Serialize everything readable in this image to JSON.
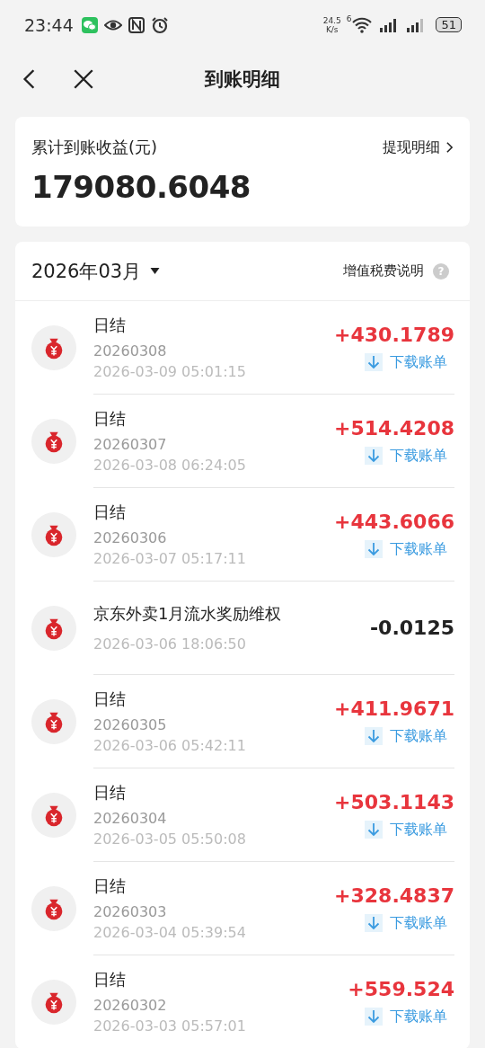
{
  "status_bar": {
    "time": "23:44",
    "net_speed": "24.5",
    "net_unit": "K/s",
    "wifi_badge": "6",
    "battery": "51"
  },
  "header": {
    "title": "到账明细"
  },
  "summary": {
    "label": "累计到账收益(元)",
    "link": "提现明细",
    "total": "179080.6048"
  },
  "list": {
    "month": "2026年03月",
    "tax_note": "增值税费说明",
    "help": "?",
    "items": [
      {
        "kind": "daily",
        "title": "日结",
        "code": "20260308",
        "time": "2026-03-09 05:01:15",
        "amount": "+430.1789",
        "income": true,
        "action": "下载账单"
      },
      {
        "kind": "daily",
        "title": "日结",
        "code": "20260307",
        "time": "2026-03-08 06:24:05",
        "amount": "+514.4208",
        "income": true,
        "action": "下载账单"
      },
      {
        "kind": "daily",
        "title": "日结",
        "code": "20260306",
        "time": "2026-03-07 05:17:11",
        "amount": "+443.6066",
        "income": true,
        "action": "下载账单"
      },
      {
        "kind": "adjustment",
        "title": "京东外卖1月流水奖励维权",
        "time": "2026-03-06 18:06:50",
        "amount": "-0.0125",
        "income": false
      },
      {
        "kind": "daily",
        "title": "日结",
        "code": "20260305",
        "time": "2026-03-06 05:42:11",
        "amount": "+411.9671",
        "income": true,
        "action": "下载账单"
      },
      {
        "kind": "daily",
        "title": "日结",
        "code": "20260304",
        "time": "2026-03-05 05:50:08",
        "amount": "+503.1143",
        "income": true,
        "action": "下载账单"
      },
      {
        "kind": "daily",
        "title": "日结",
        "code": "20260303",
        "time": "2026-03-04 05:39:54",
        "amount": "+328.4837",
        "income": true,
        "action": "下载账单"
      },
      {
        "kind": "daily",
        "title": "日结",
        "code": "20260302",
        "time": "2026-03-03 05:57:01",
        "amount": "+559.524",
        "income": true,
        "action": "下载账单"
      }
    ]
  }
}
